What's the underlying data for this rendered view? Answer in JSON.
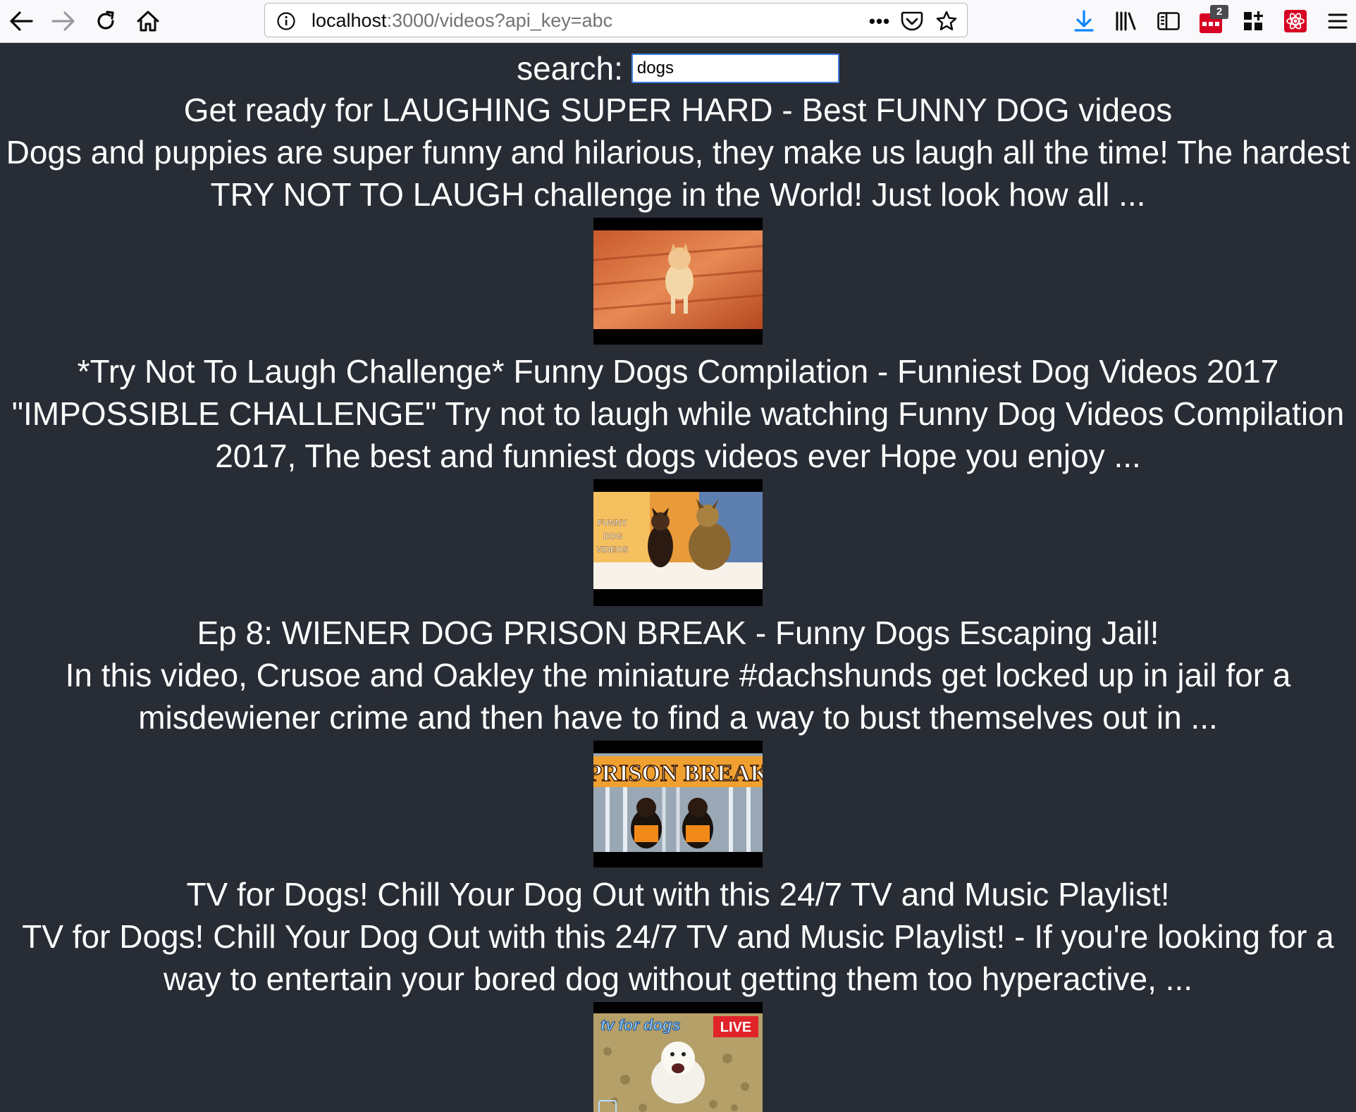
{
  "browser": {
    "url_host": "localhost",
    "url_rest": ":3000/videos?api_key=abc",
    "extension_badge_count": "2",
    "page_actions_label": "•••"
  },
  "search": {
    "label": "search:",
    "value": "dogs"
  },
  "videos": [
    {
      "title": "Get ready for LAUGHING SUPER HARD - Best FUNNY DOG videos",
      "description": "Dogs and puppies are super funny and hilarious, they make us laugh all the time! The hardest TRY NOT TO LAUGH challenge in the World! Just look how all ..."
    },
    {
      "title": "*Try Not To Laugh Challenge* Funny Dogs Compilation - Funniest Dog Videos 2017",
      "description": "\"IMPOSSIBLE CHALLENGE\" Try not to laugh while watching Funny Dog Videos Compilation 2017, The best and funniest dogs videos ever Hope you enjoy ...",
      "thumb_text": [
        "FUNNY",
        "DOG",
        "VIDEOS"
      ]
    },
    {
      "title": "Ep 8: WIENER DOG PRISON BREAK - Funny Dogs Escaping Jail!",
      "description": "In this video, Crusoe and Oakley the miniature #dachshunds get locked up in jail for a misdewiener crime and then have to find a way to bust themselves out in ...",
      "thumb_text": "PRISON BREAK"
    },
    {
      "title": "TV for Dogs! Chill Your Dog Out with this 24/7 TV and Music Playlist!",
      "description": "TV for Dogs! Chill Your Dog Out with this 24/7 TV and Music Playlist! - If you're looking for a way to entertain your bored dog without getting them too hyperactive, ...",
      "thumb_text": "tv for dogs",
      "thumb_badge": "LIVE"
    }
  ]
}
